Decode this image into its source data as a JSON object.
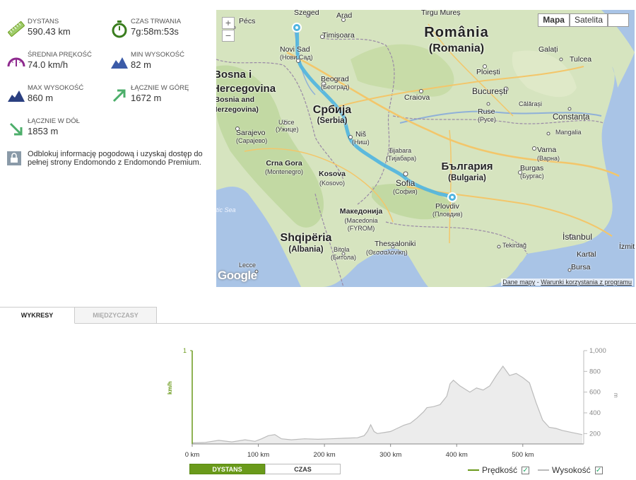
{
  "stats": [
    {
      "label": "DYSTANS",
      "value": "590.43 km",
      "icon": "ruler-icon"
    },
    {
      "label": "CZAS TRWANIA",
      "value": "7g:58m:53s",
      "icon": "stopwatch-icon"
    },
    {
      "label": "ŚREDNIA PRĘKOŚĆ",
      "value": "74.0 km/h",
      "icon": "speedometer-icon"
    },
    {
      "label": "MIN WYSOKOŚĆ",
      "value": "82 m",
      "icon": "mountain-low-icon"
    },
    {
      "label": "MAX WYSOKOŚĆ",
      "value": "860 m",
      "icon": "mountain-high-icon"
    },
    {
      "label": "ŁĄCZNIE W GÓRĘ",
      "value": "1672 m",
      "icon": "arrow-up-right-icon"
    },
    {
      "label": "ŁĄCZNIE W DÓŁ",
      "value": "1853 m",
      "icon": "arrow-down-right-icon"
    }
  ],
  "promo": {
    "text": "Odblokuj informację pogodową i uzyskaj dostęp do pełnej strony Endomondo z Endomondo Premium."
  },
  "map": {
    "zoom_in": "+",
    "zoom_out": "−",
    "types": {
      "map": "Mapa",
      "satellite": "Satelita"
    },
    "attribution": "Google",
    "terms": {
      "data": "Dane mapy",
      "sep": " - ",
      "use": "Warunki korzystania z programu"
    },
    "labels": {
      "szeged": "Szeged",
      "arad": "Arad",
      "tirgu": "Tirgu Mureș",
      "pecs": "Pécs",
      "timisoara": "Timișoara",
      "novisad": "Novi Sad",
      "novisad_c": "(Нови Сад)",
      "romania": "România",
      "romania_sub": "(Romania)",
      "galati": "Galați",
      "tulcea": "Tulcea",
      "ploiesti": "Ploiești",
      "bucuresti": "București",
      "beograd": "Beograd",
      "beograd_c": "(Београд)",
      "bosna1": "Bosna i",
      "bosna2": "Hercegovina",
      "bosna3": "(Bosnia and",
      "bosna4": "Herzegovina)",
      "srbija": "Србија",
      "srbija_sub": "(Serbia)",
      "craiova": "Craiova",
      "calarasi": "Călărași",
      "ruse": "Ruse",
      "ruse_c": "(Русе)",
      "constanta": "Constanța",
      "sarajevo": "Sarajevo",
      "sarajevo_c": "(Сарајево)",
      "uzice": "Užice",
      "uzice_c": "(Ужице)",
      "nis": "Niš",
      "nis_c": "(Ниш)",
      "mangalia": "Mangalia",
      "varna": "Varna",
      "varna_c": "(Варна)",
      "tijabara": "Tijabara",
      "tijabara_c": "(Тијабара)",
      "bulgaria": "България",
      "bulgaria_sub": "(Bulgaria)",
      "crnagora": "Crna Gora",
      "crnagora_sub": "(Montenegro)",
      "kosova": "Kosova",
      "kosova_sub": "(Kosovo)",
      "sofia": "Sofia",
      "sofia_c": "(София)",
      "burgas": "Burgas",
      "burgas_c": "(Бургас)",
      "plovdiv": "Plovdiv",
      "plovdiv_c": "(Пловдив)",
      "sea": "tic Sea",
      "makedonija": "Македонија",
      "makedonija_sub1": "(Macedonia",
      "makedonija_sub2": "(FYROM)",
      "shqiperia": "Shqipëria",
      "shqiperia_sub": "(Albania)",
      "thessaloniki": "Thessaloniki",
      "thessaloniki_c": "(Θεσσαλονίκη)",
      "bitola": "Bitola",
      "bitola_c": "(Битола)",
      "istanbul": "İstanbul",
      "tekirdag": "Tekirdağ",
      "kartal": "Kartal",
      "izmit": "İzmit",
      "bursa": "Bursa",
      "lecce": "Lecce"
    }
  },
  "tabs": [
    {
      "label": "WYKRESY",
      "active": true
    },
    {
      "label": "MIĘDZYCZASY",
      "active": false
    }
  ],
  "chart_toggle": {
    "distance": "DYSTANS",
    "time": "CZAS"
  },
  "legend": {
    "speed": "Prędkość",
    "elevation": "Wysokość"
  },
  "colors": {
    "speed": "#6a9a1b",
    "elevation": "#bbbbbb",
    "route": "#4fb4e0",
    "accent": "#6a9a1b"
  },
  "chart_data": {
    "type": "area",
    "xlabel": "",
    "ylabel_left": "km/h",
    "ylabel_right": "m",
    "x_ticks": [
      "0 km",
      "100 km",
      "200 km",
      "300 km",
      "400 km",
      "500 km"
    ],
    "x_tick_values": [
      0,
      100,
      200,
      300,
      400,
      500
    ],
    "xlim": [
      0,
      590
    ],
    "y_left_ticks": [
      "1"
    ],
    "y_left_lim": [
      0,
      1
    ],
    "y_right_ticks": [
      "1,000",
      "800",
      "600",
      "400",
      "200"
    ],
    "y_right_tick_values": [
      1000,
      800,
      600,
      400,
      200
    ],
    "y_right_lim": [
      100,
      1000
    ],
    "series": [
      {
        "name": "Wysokość",
        "axis": "right",
        "x": [
          0,
          20,
          40,
          60,
          80,
          95,
          105,
          115,
          125,
          135,
          150,
          170,
          190,
          210,
          230,
          250,
          260,
          265,
          270,
          275,
          280,
          290,
          300,
          310,
          320,
          330,
          340,
          350,
          355,
          365,
          375,
          385,
          390,
          395,
          405,
          420,
          430,
          440,
          450,
          460,
          470,
          480,
          490,
          500,
          510,
          520,
          530,
          540,
          550,
          560,
          575,
          590
        ],
        "values": [
          110,
          115,
          135,
          120,
          140,
          125,
          150,
          180,
          190,
          150,
          140,
          150,
          145,
          150,
          155,
          160,
          180,
          220,
          285,
          220,
          200,
          210,
          220,
          250,
          280,
          300,
          350,
          410,
          450,
          460,
          480,
          560,
          680,
          715,
          660,
          600,
          640,
          620,
          660,
          760,
          850,
          760,
          780,
          740,
          690,
          500,
          330,
          260,
          250,
          230,
          210,
          190
        ]
      },
      {
        "name": "Prędkość",
        "axis": "left",
        "x": [],
        "values": []
      }
    ]
  }
}
